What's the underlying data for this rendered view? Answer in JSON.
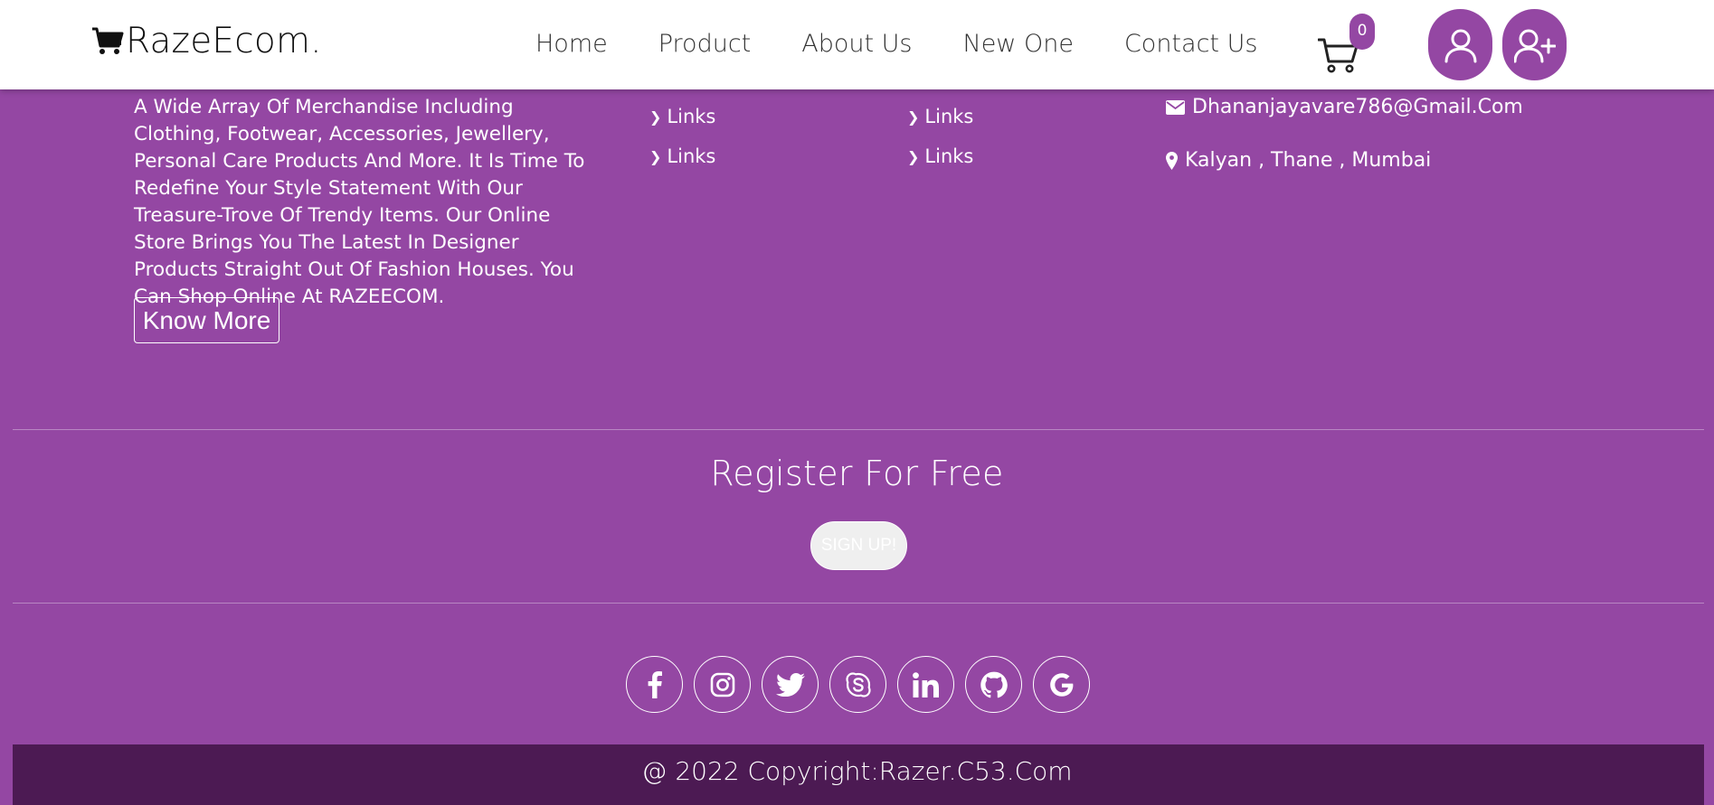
{
  "brand": {
    "name": "RazeEcom.",
    "logo_icon": "cart-icon"
  },
  "nav": {
    "items": [
      {
        "label": "Home"
      },
      {
        "label": "Product"
      },
      {
        "label": "About Us"
      },
      {
        "label": "New One"
      },
      {
        "label": "Contact Us"
      }
    ],
    "cart_count": "0",
    "login_icon": "user-icon",
    "signup_icon": "user-plus-icon"
  },
  "about": {
    "text": "A Wide Array Of Merchandise Including Clothing, Footwear, Accessories, Jewellery, Personal Care Products And More. It Is Time To Redefine Your Style Statement With Our Treasure-Trove Of Trendy Items. Our Online Store Brings You The Latest In Designer Products Straight Out Of Fashion Houses. You Can Shop Online At RAZEECOM.",
    "button_label": "Know More"
  },
  "links_col1": [
    "Links",
    "Links"
  ],
  "links_col2": [
    "Links",
    "Links"
  ],
  "contact": {
    "email": "Dhananjayavare786@Gmail.Com",
    "location": "Kalyan , Thane , Mumbai"
  },
  "register": {
    "title": "Register For Free",
    "button_label": "SIGN UP!"
  },
  "social": [
    "facebook-icon",
    "instagram-icon",
    "twitter-icon",
    "skype-icon",
    "linkedin-icon",
    "github-icon",
    "google-icon"
  ],
  "footer": {
    "copyright": "@ 2022 Copyright:Razer.C53.Com"
  },
  "colors": {
    "primary": "#9447a3",
    "dark": "#4c1a53",
    "white": "#ffffff"
  }
}
